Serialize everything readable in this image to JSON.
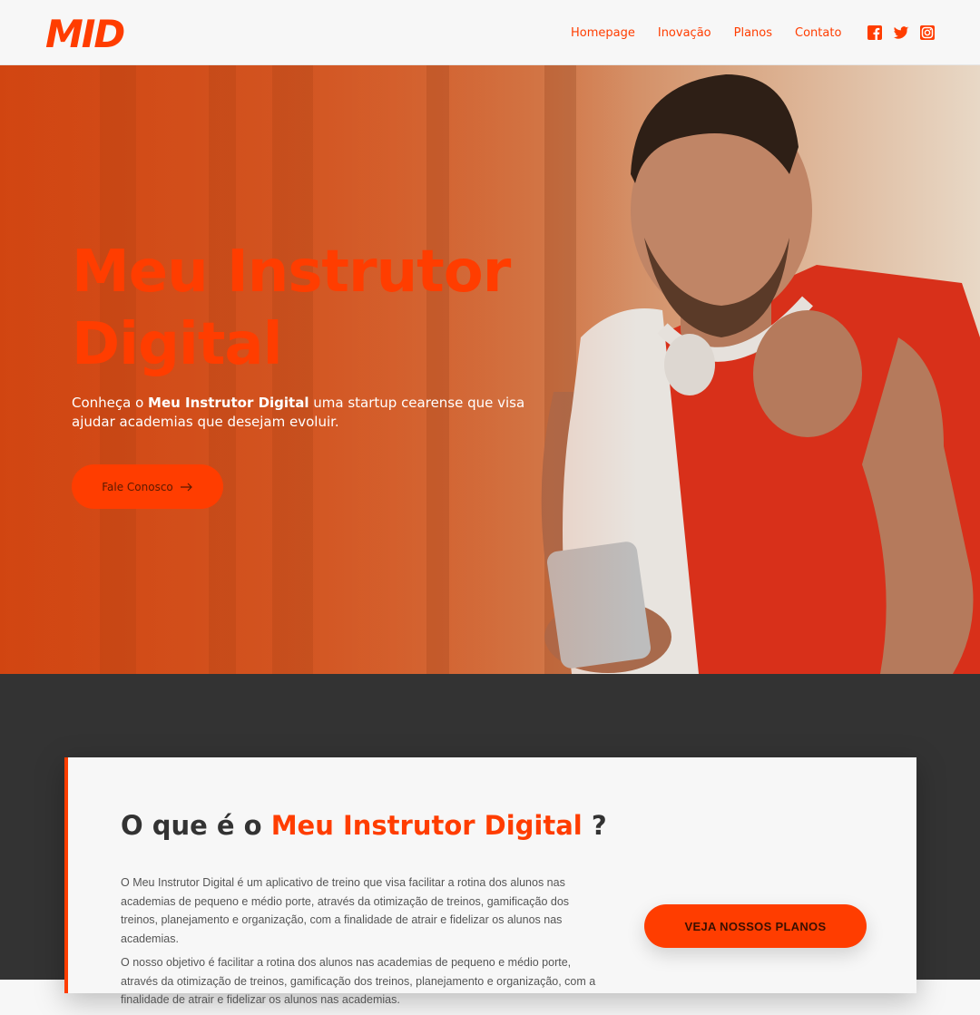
{
  "brand": {
    "logo_text": "MID",
    "accent_color": "#ff3d00"
  },
  "nav": {
    "items": [
      {
        "label": "Homepage"
      },
      {
        "label": "Inovação"
      },
      {
        "label": "Planos"
      },
      {
        "label": "Contato"
      }
    ],
    "social": [
      "facebook-icon",
      "twitter-icon",
      "instagram-icon"
    ]
  },
  "hero": {
    "title_line1": "Meu Instrutor",
    "title_line2": "Digital",
    "desc_prefix": "Conheça o ",
    "desc_bold": "Meu Instrutor Digital",
    "desc_suffix": " uma startup cearense que visa ajudar academias que desejam evoluir.",
    "cta_label": "Fale Conosco"
  },
  "about": {
    "title_prefix": "O que é o ",
    "title_accent": "Meu Instrutor Digital",
    "title_suffix": " ?",
    "paragraph1": "O Meu Instrutor Digital é um aplicativo de treino que visa facilitar a rotina dos alunos nas academias de pequeno e médio porte, através da otimização de treinos, gamificação dos treinos, planejamento e organização, com a finalidade de atrair e fidelizar os alunos nas academias.",
    "paragraph2": "O nosso objetivo é facilitar a rotina dos alunos nas academias de pequeno e médio porte, através da otimização de treinos, gamificação dos treinos, planejamento e organização, com a finalidade de atrair e fidelizar os alunos nas academias.",
    "cta_label": "VEJA NOSSOS PLANOS"
  }
}
